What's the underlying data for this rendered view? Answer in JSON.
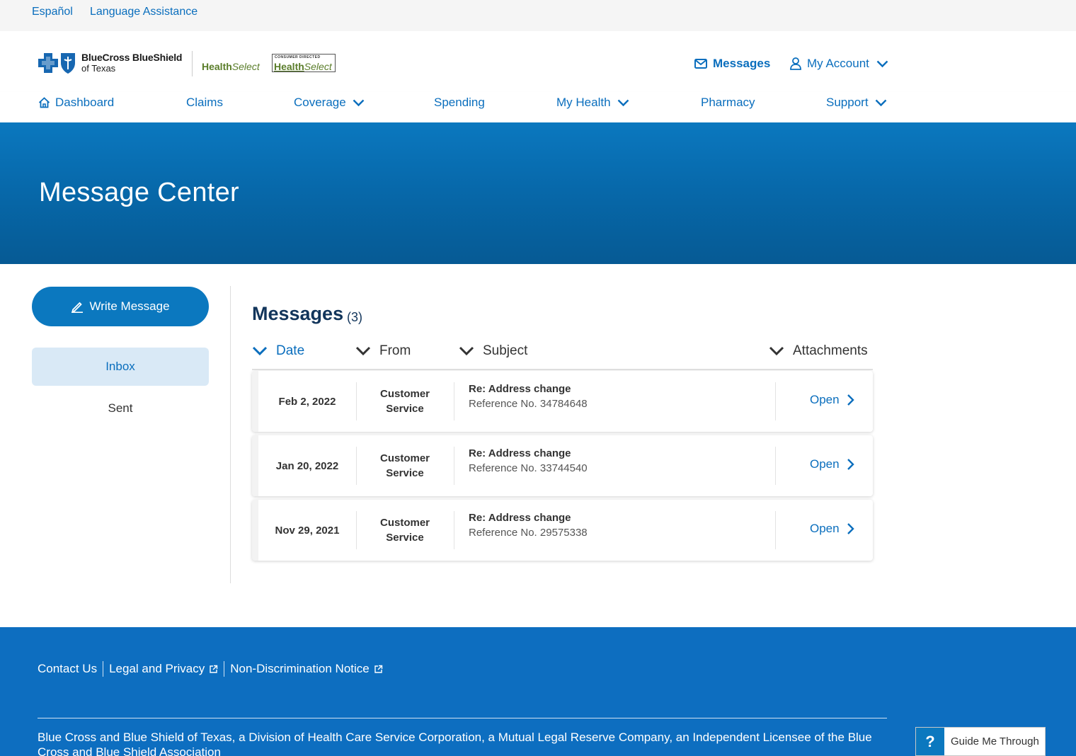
{
  "utility": {
    "espanol": "Español",
    "language_assistance": "Language Assistance"
  },
  "brand": {
    "logo_line1": "BlueCross BlueShield",
    "logo_line2": "of Texas",
    "hs_health": "Health",
    "hs_select": "Select",
    "cdhs_top": "CONSUMER DIRECTED",
    "cdhs_health": "Health",
    "cdhs_select": "Select"
  },
  "header": {
    "messages_label": "Messages",
    "account_label": "My Account"
  },
  "nav": {
    "dashboard": "Dashboard",
    "claims": "Claims",
    "coverage": "Coverage",
    "spending": "Spending",
    "my_health": "My Health",
    "pharmacy": "Pharmacy",
    "support": "Support"
  },
  "hero": {
    "title": "Message Center"
  },
  "sidebar": {
    "write_label": "Write Message",
    "inbox_label": "Inbox",
    "sent_label": "Sent"
  },
  "messages": {
    "title": "Messages",
    "count": "(3)",
    "columns": {
      "date": "Date",
      "from": "From",
      "subject": "Subject",
      "attachments": "Attachments"
    },
    "rows": [
      {
        "date": "Feb 2, 2022",
        "from_line1": "Customer",
        "from_line2": "Service",
        "subject": "Re: Address change",
        "reference": "Reference No. 34784648",
        "action": "Open"
      },
      {
        "date": "Jan 20, 2022",
        "from_line1": "Customer",
        "from_line2": "Service",
        "subject": "Re: Address change",
        "reference": "Reference No. 33744540",
        "action": "Open"
      },
      {
        "date": "Nov 29, 2021",
        "from_line1": "Customer",
        "from_line2": "Service",
        "subject": "Re: Address change",
        "reference": "Reference No. 29575338",
        "action": "Open"
      }
    ]
  },
  "footer": {
    "contact": "Contact Us",
    "legal": "Legal and Privacy",
    "nondiscrimination": "Non-Discrimination Notice",
    "disclaimer": "Blue Cross and Blue Shield of Texas, a Division of Health Care Service Corporation, a Mutual Legal Reserve Company, an Independent Licensee of the Blue Cross and Blue Shield Association"
  },
  "guide": {
    "icon": "?",
    "label": "Guide Me Through"
  },
  "colors": {
    "primary": "#0b78bf",
    "link": "#0a6ebd",
    "heading": "#12355b",
    "footer": "#0d6ec0",
    "selected_bg": "#d9e9f6"
  }
}
